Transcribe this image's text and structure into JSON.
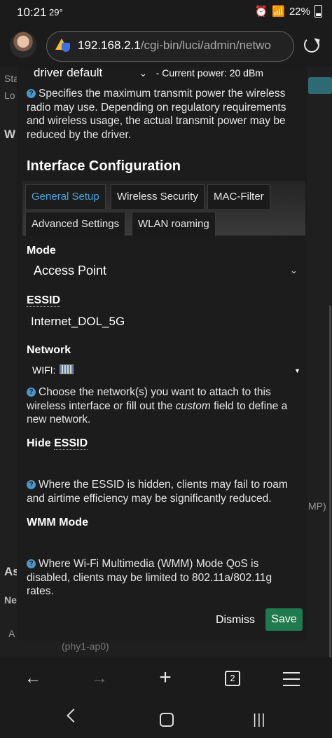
{
  "status_bar": {
    "time": "10:21",
    "temperature": "29°",
    "battery_percent": "22%",
    "icons": [
      "alarm-icon",
      "wifi-icon",
      "signal-icon",
      "battery-icon"
    ]
  },
  "browser": {
    "url_host": "192.168.2.1",
    "url_path": "/cgi-bin/luci/admin/netwo",
    "open_tabs": "2"
  },
  "background_page": {
    "text_1": "Sta",
    "text_2": "Lo",
    "heading_1": "W",
    "heading_2": "As",
    "label_ne": "Ne",
    "label_a": "A",
    "text_mp": "MP)",
    "device_id": "(phy1-ap0)"
  },
  "modal": {
    "tx_power": {
      "value": "driver default",
      "current": "- Current power: 20 dBm",
      "help": "Specifies the maximum transmit power the wireless radio may use. Depending on regulatory requirements and wireless usage, the actual transmit power may be reduced by the driver."
    },
    "section_title": "Interface Configuration",
    "tabs": [
      {
        "label": "General Setup",
        "active": true
      },
      {
        "label": "Wireless Security",
        "active": false
      },
      {
        "label": "MAC-Filter",
        "active": false
      },
      {
        "label": "Advanced Settings",
        "active": false
      },
      {
        "label": "WLAN roaming",
        "active": false
      }
    ],
    "mode": {
      "label": "Mode",
      "value": "Access Point"
    },
    "essid": {
      "label": "ESSID",
      "value": "Internet_DOL_5G"
    },
    "network": {
      "label": "Network",
      "value": "WIFI:",
      "help_prefix": "Choose the network(s) you want to attach to this wireless interface or fill out the ",
      "help_em": "custom",
      "help_suffix": " field to define a new network."
    },
    "hide_essid": {
      "label_prefix": "Hide ",
      "label_term": "ESSID",
      "help": "Where the ESSID is hidden, clients may fail to roam and airtime efficiency may be significantly reduced."
    },
    "wmm_mode": {
      "label": "WMM Mode",
      "help": "Where Wi-Fi Multimedia (WMM) Mode QoS is disabled, clients may be limited to 802.11a/802.11g rates."
    },
    "dismiss_label": "Dismiss",
    "save_label": "Save"
  },
  "colors": {
    "accent": "#4aa3d8",
    "save_button": "#1f7a4d",
    "help_icon": "#4a96c8"
  }
}
